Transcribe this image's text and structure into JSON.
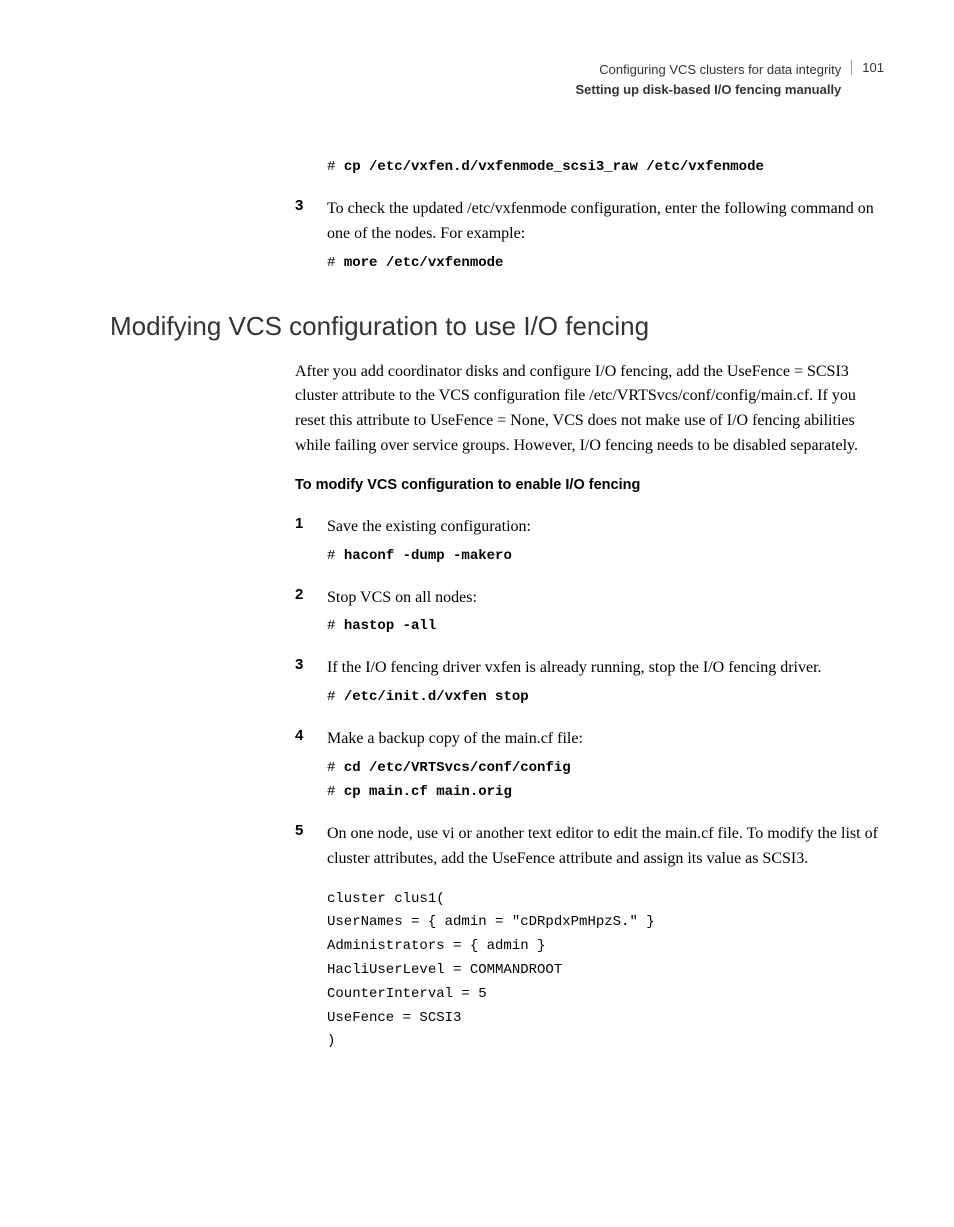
{
  "header": {
    "title": "Configuring VCS clusters for data integrity",
    "subtitle": "Setting up disk-based I/O fencing manually",
    "page": "101"
  },
  "top_code_prefix": "# ",
  "top_code_cmd": "cp /etc/vxfen.d/vxfenmode_scsi3_raw /etc/vxfenmode",
  "step3_top": {
    "num": "3",
    "text": "To check the updated /etc/vxfenmode configuration, enter the following command on one of the nodes. For example:",
    "code_prefix": "# ",
    "code_cmd": "more /etc/vxfenmode"
  },
  "h2": "Modifying VCS configuration to use I/O fencing",
  "intro": "After you add coordinator disks and configure I/O fencing, add the UseFence = SCSI3 cluster attribute to the VCS configuration file /etc/VRTSvcs/conf/config/main.cf. If you reset this attribute to UseFence = None, VCS does not make use of I/O fencing abilities while failing over service groups. However, I/O fencing needs to be disabled separately.",
  "subhead": "To modify VCS configuration to enable I/O fencing",
  "steps": {
    "s1": {
      "num": "1",
      "text": "Save the existing configuration:",
      "code_prefix": "# ",
      "code_cmd": "haconf -dump -makero"
    },
    "s2": {
      "num": "2",
      "text": "Stop VCS on all nodes:",
      "code_prefix": "# ",
      "code_cmd": "hastop -all"
    },
    "s3": {
      "num": "3",
      "text": "If the I/O fencing driver vxfen is already running, stop the I/O fencing driver.",
      "code_prefix": "# ",
      "code_cmd": "/etc/init.d/vxfen stop"
    },
    "s4": {
      "num": "4",
      "text": "Make a backup copy of the main.cf file:",
      "code_prefix1": "# ",
      "code_cmd1": "cd /etc/VRTSvcs/conf/config",
      "code_prefix2": "# ",
      "code_cmd2": "cp main.cf main.orig"
    },
    "s5": {
      "num": "5",
      "text": "On one node, use vi or another text editor to edit the main.cf file. To modify the list of cluster attributes, add the UseFence attribute and assign its value as SCSI3.",
      "block_l1": "cluster clus1(",
      "block_l2": "UserNames = { admin = \"cDRpdxPmHpzS.\" }",
      "block_l3": "Administrators = { admin }",
      "block_l4": "HacliUserLevel = COMMANDROOT",
      "block_l5": "CounterInterval = 5",
      "block_l6": "UseFence = SCSI3",
      "block_l7": ")"
    }
  }
}
